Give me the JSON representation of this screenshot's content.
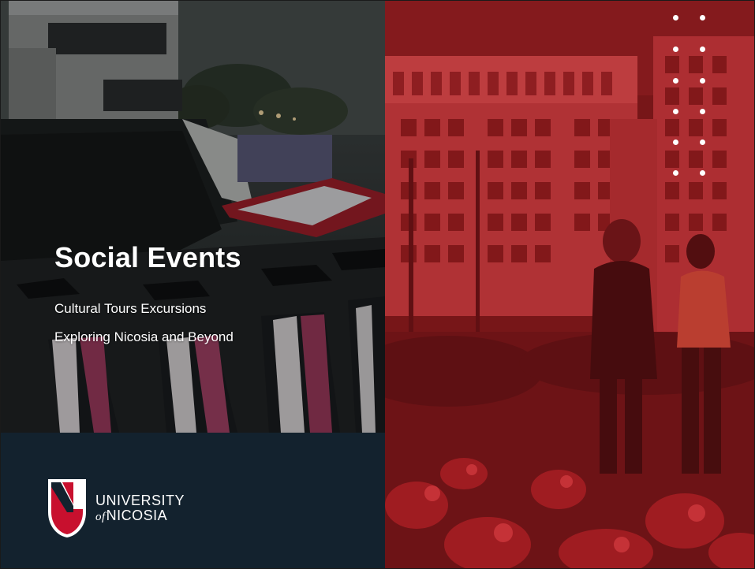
{
  "slide": {
    "title": "Social Events",
    "subtitle_line1": "Cultural Tours Excursions",
    "subtitle_line2": "Exploring Nicosia and Beyond"
  },
  "logo": {
    "line1": "UNIVERSITY",
    "line2_prefix": "of",
    "line2": "NICOSIA"
  },
  "colors": {
    "navy_footer": "#13222e",
    "brand_red": "#c8102e",
    "overlay_red": "#8e1a1d"
  },
  "images": {
    "left": "graduation-ceremony-photo",
    "right": "campus-building-students-photo"
  }
}
